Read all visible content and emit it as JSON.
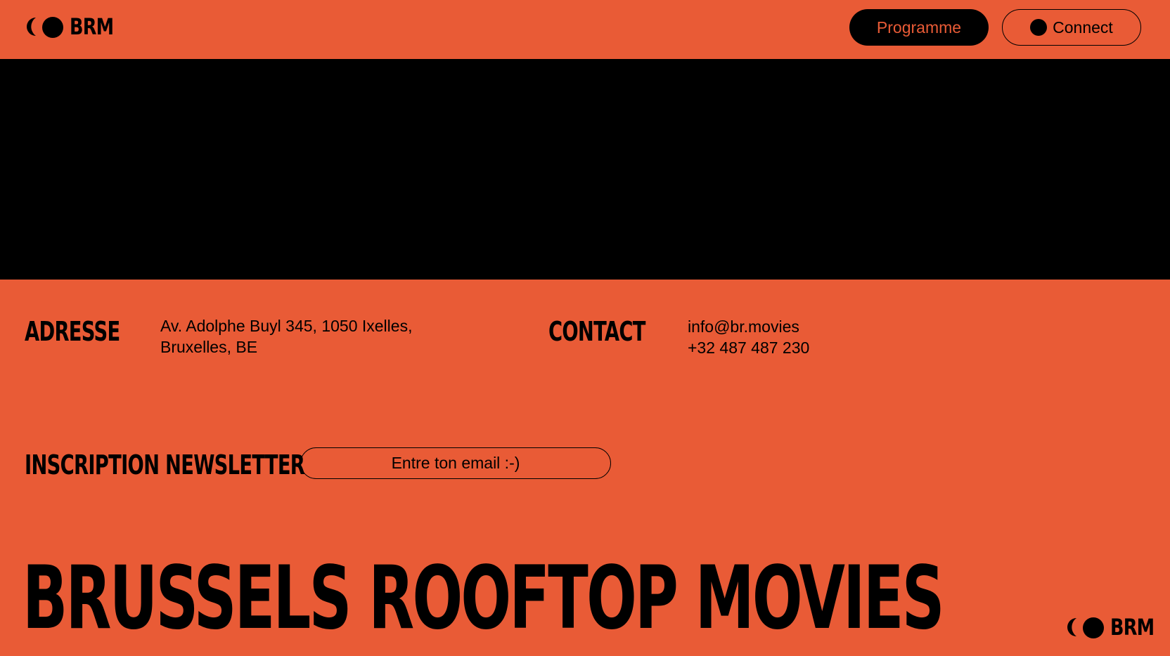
{
  "header": {
    "logo_text": "BRM",
    "buttons": {
      "programme": "Programme",
      "connect": "Connect"
    }
  },
  "address": {
    "heading": "ADRESSE",
    "line1": "Av. Adolphe Buyl 345, 1050 Ixelles,",
    "line2": "Bruxelles, BE"
  },
  "contact": {
    "heading": "CONTACT",
    "email": "info@br.movies",
    "phone": "+32 487 487 230"
  },
  "newsletter": {
    "heading": "INSCRIPTION NEWSLETTER",
    "placeholder": "Entre ton email :-)"
  },
  "footer": {
    "title": "BRUSSELS ROOFTOP MOVIES",
    "logo_text": "BRM"
  },
  "colors": {
    "background": "#e95b36",
    "banner": "#000000",
    "text": "#000000"
  },
  "icons": {
    "logo_crescent": "crescent-moon-icon",
    "logo_dot": "full-moon-icon",
    "connect_dot": "dot-icon"
  }
}
